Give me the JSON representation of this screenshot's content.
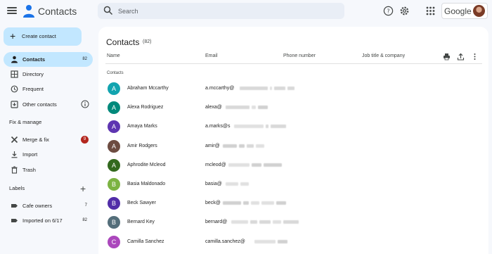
{
  "header": {
    "app_title": "Contacts",
    "search_placeholder": "Search",
    "brand": "Google",
    "colors": {
      "google_blue": "#1a73e8"
    }
  },
  "sidebar": {
    "create_label": "Create contact",
    "items": [
      {
        "label": "Contacts",
        "count": "82",
        "icon": "person-icon",
        "active": true
      },
      {
        "label": "Directory",
        "icon": "directory-icon"
      },
      {
        "label": "Frequent",
        "icon": "history-icon"
      },
      {
        "label": "Other contacts",
        "icon": "other-contacts-icon"
      }
    ],
    "fix_manage_heading": "Fix & manage",
    "fix_items": [
      {
        "label": "Merge & fix",
        "badge": "9",
        "icon": "merge-icon"
      },
      {
        "label": "Import",
        "icon": "import-icon"
      },
      {
        "label": "Trash",
        "icon": "trash-icon"
      }
    ],
    "labels_heading": "Labels",
    "labels": [
      {
        "label": "Cafe owners",
        "count": "7",
        "icon": "label-icon"
      },
      {
        "label": "Imported on 6/17",
        "count": "82",
        "icon": "label-icon"
      }
    ]
  },
  "main": {
    "title": "Contacts",
    "count": "(82)",
    "columns": [
      "Name",
      "Email",
      "Phone number",
      "Job title & company"
    ],
    "group_label": "Contacts",
    "contacts": [
      {
        "initial": "A",
        "name": "Abraham Mccarthy",
        "email": "a.mccarthy@",
        "color": "#12a4af"
      },
      {
        "initial": "A",
        "name": "Alexa Rodriguez",
        "email": "alexa@",
        "color": "#00897b"
      },
      {
        "initial": "A",
        "name": "Amaya Marks",
        "email": "a.marks@s",
        "color": "#5e35b1"
      },
      {
        "initial": "A",
        "name": "Amir Rodgers",
        "email": "amir@",
        "color": "#6d4c41"
      },
      {
        "initial": "A",
        "name": "Aphrodite Mcleod",
        "email": "mcleod@",
        "color": "#33691e"
      },
      {
        "initial": "B",
        "name": "Basia Maldonado",
        "email": "basia@",
        "color": "#7cb342"
      },
      {
        "initial": "B",
        "name": "Beck Sawyer",
        "email": "beck@",
        "color": "#512da8"
      },
      {
        "initial": "B",
        "name": "Bernard Key",
        "email": "bernard@",
        "color": "#546e7a"
      },
      {
        "initial": "C",
        "name": "Camilla Sanchez",
        "email": "camilla.sanchez@",
        "color": "#ab47bc"
      }
    ]
  }
}
